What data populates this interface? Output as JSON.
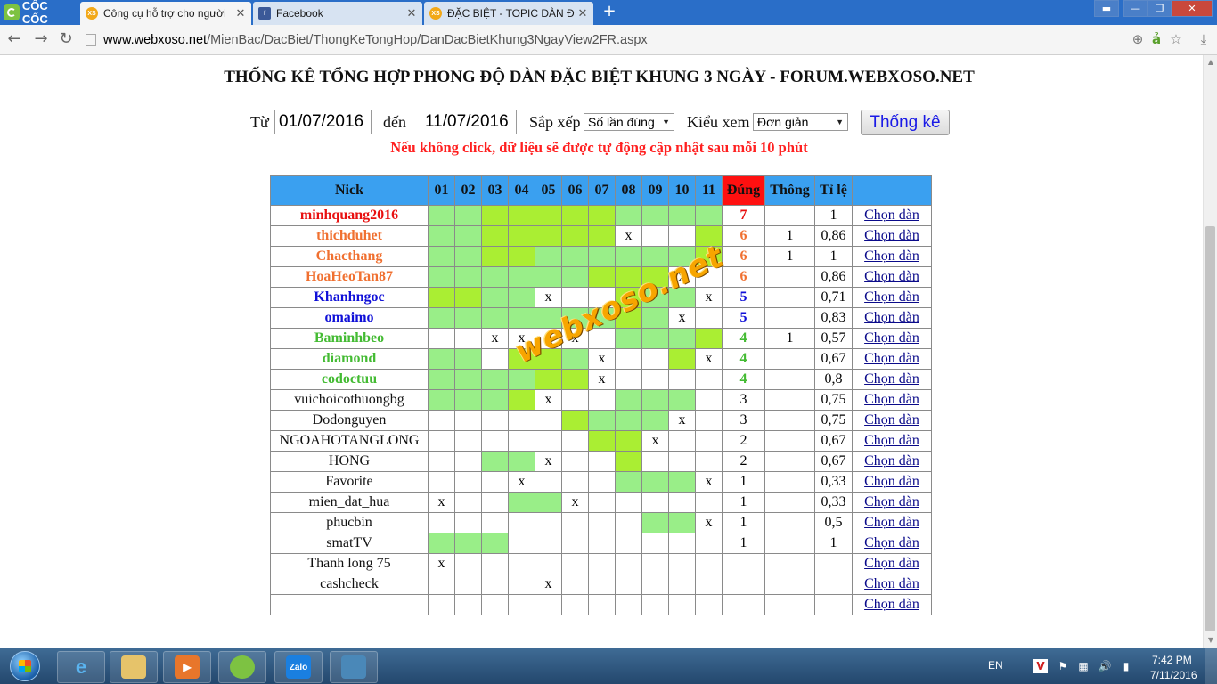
{
  "browser": {
    "brand": "CỐC CỐC",
    "tabs": [
      {
        "title": "Công cụ hỗ trợ cho người",
        "favicon": "XS",
        "active": true
      },
      {
        "title": "Facebook",
        "favicon": "f",
        "active": false
      },
      {
        "title": "ĐẶC BIỆT - TOPIC DÀN Đ",
        "favicon": "XS",
        "active": false
      }
    ],
    "url_host": "www.webxoso.net",
    "url_path": "/MienBac/DacBiet/ThongKeTongHop/DanDacBietKhung3NgayView2FR.aspx"
  },
  "page": {
    "title": "THỐNG KÊ TỔNG HỢP PHONG ĐỘ DÀN ĐẶC BIỆT KHUNG 3 NGÀY - FORUM.WEBXOSO.NET",
    "from_label": "Từ",
    "from_date": "01/07/2016",
    "to_label": "đến",
    "to_date": "11/07/2016",
    "sort_label": "Sắp xếp",
    "sort_value": "Số lần đúng",
    "view_label": "Kiểu xem",
    "view_value": "Đơn giản",
    "stat_button": "Thống kê",
    "notice": "Nếu không click, dữ liệu sẽ được tự động cập nhật sau mỗi 10 phút",
    "watermark": "webxoso.net"
  },
  "table": {
    "headers": [
      "Nick",
      "01",
      "02",
      "03",
      "04",
      "05",
      "06",
      "07",
      "08",
      "09",
      "10",
      "11",
      "Đúng",
      "Thông",
      "Tỉ lệ",
      ""
    ],
    "link_label": "Chọn dàn",
    "rows": [
      {
        "nick": "minhquang2016",
        "color": "red",
        "cells": [
          "g",
          "g",
          "y",
          "y",
          "y",
          "y",
          "y",
          "g",
          "g",
          "g",
          "g"
        ],
        "marks": [
          "",
          "",
          "",
          "",
          "",
          "",
          "",
          "",
          "",
          "",
          ""
        ],
        "dung": "7",
        "thong": "",
        "tile": "1"
      },
      {
        "nick": "thichduhet",
        "color": "orange",
        "cells": [
          "g",
          "g",
          "y",
          "y",
          "y",
          "y",
          "y",
          "w",
          "w",
          "w",
          "y"
        ],
        "marks": [
          "",
          "",
          "",
          "",
          "",
          "",
          "",
          "x",
          "",
          "",
          ""
        ],
        "dung": "6",
        "thong": "1",
        "tile": "0,86"
      },
      {
        "nick": "Chacthang",
        "color": "orange",
        "cells": [
          "g",
          "g",
          "y",
          "y",
          "g",
          "g",
          "g",
          "g",
          "g",
          "g",
          "y"
        ],
        "marks": [
          "",
          "",
          "",
          "",
          "",
          "",
          "",
          "",
          "",
          "",
          ""
        ],
        "dung": "6",
        "thong": "1",
        "tile": "1"
      },
      {
        "nick": "HoaHeoTan87",
        "color": "orange",
        "cells": [
          "g",
          "g",
          "g",
          "g",
          "g",
          "g",
          "y",
          "y",
          "y",
          "w",
          "w"
        ],
        "marks": [
          "",
          "",
          "",
          "",
          "",
          "",
          "",
          "",
          "",
          "x",
          ""
        ],
        "dung": "6",
        "thong": "",
        "tile": "0,86"
      },
      {
        "nick": "Khanhngoc",
        "color": "blue",
        "cells": [
          "y",
          "y",
          "g",
          "g",
          "w",
          "w",
          "w",
          "y",
          "g",
          "g",
          "w"
        ],
        "marks": [
          "",
          "",
          "",
          "",
          "x",
          "",
          "",
          "",
          "",
          "",
          "x"
        ],
        "dung": "5",
        "thong": "",
        "tile": "0,71"
      },
      {
        "nick": "omaimo",
        "color": "blue",
        "cells": [
          "g",
          "g",
          "g",
          "g",
          "g",
          "g",
          "g",
          "y",
          "g",
          "w",
          "w"
        ],
        "marks": [
          "",
          "",
          "",
          "",
          "",
          "",
          "",
          "",
          "",
          "x",
          ""
        ],
        "dung": "5",
        "thong": "",
        "tile": "0,83"
      },
      {
        "nick": "Baminhbeo",
        "color": "green",
        "cells": [
          "w",
          "w",
          "w",
          "w",
          "w",
          "w",
          "w",
          "g",
          "g",
          "g",
          "y"
        ],
        "marks": [
          "",
          "",
          "x",
          "x",
          "",
          "x",
          "",
          "",
          "",
          "",
          ""
        ],
        "dung": "4",
        "thong": "1",
        "tile": "0,57"
      },
      {
        "nick": "diamond",
        "color": "green",
        "cells": [
          "g",
          "g",
          "w",
          "y",
          "y",
          "g",
          "w",
          "w",
          "w",
          "y",
          "w"
        ],
        "marks": [
          "",
          "",
          "",
          "",
          "",
          "",
          "x",
          "",
          "",
          "",
          "x"
        ],
        "dung": "4",
        "thong": "",
        "tile": "0,67"
      },
      {
        "nick": "codoctuu",
        "color": "green",
        "cells": [
          "g",
          "g",
          "g",
          "g",
          "y",
          "y",
          "w",
          "w",
          "w",
          "w",
          "w"
        ],
        "marks": [
          "",
          "",
          "",
          "",
          "",
          "",
          "x",
          "",
          "",
          "",
          ""
        ],
        "dung": "4",
        "thong": "",
        "tile": "0,8"
      },
      {
        "nick": "vuichoicothuongbg",
        "color": "black",
        "cells": [
          "g",
          "g",
          "g",
          "y",
          "w",
          "w",
          "w",
          "g",
          "g",
          "g",
          "w"
        ],
        "marks": [
          "",
          "",
          "",
          "",
          "x",
          "",
          "",
          "",
          "",
          "",
          ""
        ],
        "dung": "3",
        "thong": "",
        "tile": "0,75"
      },
      {
        "nick": "Dodonguyen",
        "color": "black",
        "cells": [
          "w",
          "w",
          "w",
          "w",
          "w",
          "y",
          "g",
          "g",
          "g",
          "w",
          "w"
        ],
        "marks": [
          "",
          "",
          "",
          "",
          "",
          "",
          "",
          "",
          "",
          "x",
          ""
        ],
        "dung": "3",
        "thong": "",
        "tile": "0,75"
      },
      {
        "nick": "NGOAHOTANGLONG",
        "color": "black",
        "cells": [
          "w",
          "w",
          "w",
          "w",
          "w",
          "w",
          "y",
          "y",
          "w",
          "w",
          "w"
        ],
        "marks": [
          "",
          "",
          "",
          "",
          "",
          "",
          "",
          "",
          "x",
          "",
          ""
        ],
        "dung": "2",
        "thong": "",
        "tile": "0,67"
      },
      {
        "nick": "HONG",
        "color": "black",
        "cells": [
          "w",
          "w",
          "g",
          "g",
          "w",
          "w",
          "w",
          "y",
          "w",
          "w",
          "w"
        ],
        "marks": [
          "",
          "",
          "",
          "",
          "x",
          "",
          "",
          "",
          "",
          "",
          ""
        ],
        "dung": "2",
        "thong": "",
        "tile": "0,67"
      },
      {
        "nick": "Favorite",
        "color": "black",
        "cells": [
          "w",
          "w",
          "w",
          "w",
          "w",
          "w",
          "w",
          "g",
          "g",
          "g",
          "w"
        ],
        "marks": [
          "",
          "",
          "",
          "x",
          "",
          "",
          "",
          "",
          "",
          "",
          "x"
        ],
        "dung": "1",
        "thong": "",
        "tile": "0,33"
      },
      {
        "nick": "mien_dat_hua",
        "color": "black",
        "cells": [
          "w",
          "w",
          "w",
          "g",
          "g",
          "w",
          "w",
          "w",
          "w",
          "w",
          "w"
        ],
        "marks": [
          "x",
          "",
          "",
          "",
          "",
          "x",
          "",
          "",
          "",
          "",
          ""
        ],
        "dung": "1",
        "thong": "",
        "tile": "0,33"
      },
      {
        "nick": "phucbin",
        "color": "black",
        "cells": [
          "w",
          "w",
          "w",
          "w",
          "w",
          "w",
          "w",
          "w",
          "g",
          "g",
          "w"
        ],
        "marks": [
          "",
          "",
          "",
          "",
          "",
          "",
          "",
          "",
          "",
          "",
          "x"
        ],
        "dung": "1",
        "thong": "",
        "tile": "0,5"
      },
      {
        "nick": "smatTV",
        "color": "black",
        "cells": [
          "g",
          "g",
          "g",
          "w",
          "w",
          "w",
          "w",
          "w",
          "w",
          "w",
          "w"
        ],
        "marks": [
          "",
          "",
          "",
          "",
          "",
          "",
          "",
          "",
          "",
          "",
          ""
        ],
        "dung": "1",
        "thong": "",
        "tile": "1"
      },
      {
        "nick": "Thanh long 75",
        "color": "black",
        "cells": [
          "w",
          "w",
          "w",
          "w",
          "w",
          "w",
          "w",
          "w",
          "w",
          "w",
          "w"
        ],
        "marks": [
          "x",
          "",
          "",
          "",
          "",
          "",
          "",
          "",
          "",
          "",
          ""
        ],
        "dung": "",
        "thong": "",
        "tile": ""
      },
      {
        "nick": "cashcheck",
        "color": "black",
        "cells": [
          "w",
          "w",
          "w",
          "w",
          "w",
          "w",
          "w",
          "w",
          "w",
          "w",
          "w"
        ],
        "marks": [
          "",
          "",
          "",
          "",
          "x",
          "",
          "",
          "",
          "",
          "",
          ""
        ],
        "dung": "",
        "thong": "",
        "tile": ""
      },
      {
        "nick": "",
        "color": "black",
        "cells": [
          "w",
          "w",
          "w",
          "w",
          "w",
          "w",
          "w",
          "w",
          "w",
          "w",
          "w"
        ],
        "marks": [
          "",
          "",
          "",
          "",
          "",
          "",
          "",
          "",
          "",
          "",
          ""
        ],
        "dung": "",
        "thong": "",
        "tile": ""
      }
    ]
  },
  "taskbar": {
    "language": "EN",
    "time": "7:42 PM",
    "date": "7/11/2016",
    "zalo_label": "Zalo"
  },
  "colors": {
    "tabbar": "#2a6ec8",
    "header_blue": "#3aa0f0",
    "header_red": "#ff1010",
    "cell_green": "#99ee88",
    "cell_yellowgreen": "#aaee33"
  }
}
